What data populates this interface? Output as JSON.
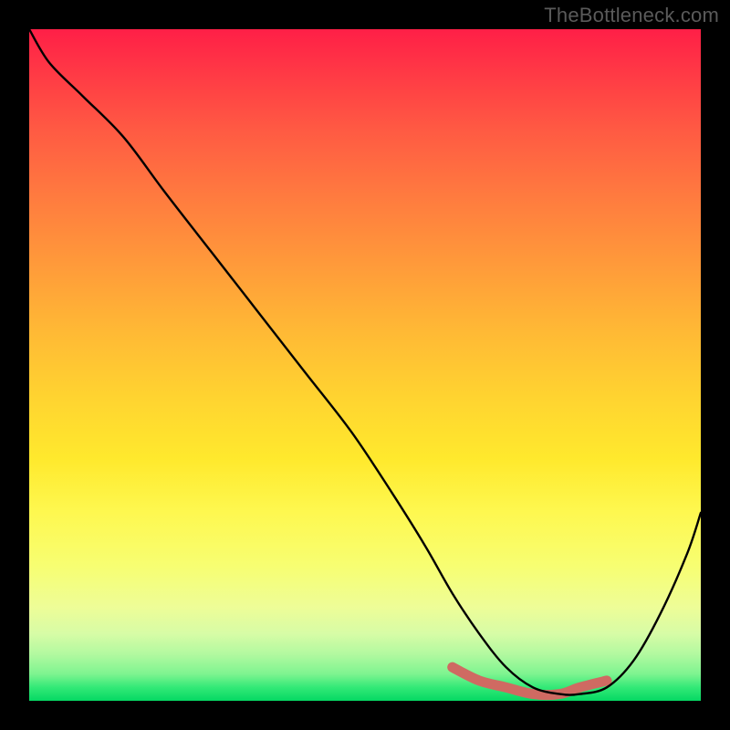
{
  "watermark": "TheBottleneck.com",
  "colors": {
    "page_bg": "#000000",
    "curve": "#000000",
    "ridge": "#cf6a62"
  },
  "chart_data": {
    "type": "line",
    "title": "",
    "xlabel": "",
    "ylabel": "",
    "xlim": [
      0,
      100
    ],
    "ylim": [
      0,
      100
    ],
    "grid": false,
    "legend": false,
    "series": [
      {
        "name": "bottleneck-curve",
        "x": [
          0,
          3,
          8,
          14,
          20,
          27,
          34,
          41,
          48,
          54,
          59,
          63,
          67,
          71,
          75,
          79,
          82,
          86,
          90,
          94,
          98,
          100
        ],
        "y": [
          100,
          95,
          90,
          84,
          76,
          67,
          58,
          49,
          40,
          31,
          23,
          16,
          10,
          5,
          2,
          1,
          1,
          2,
          6,
          13,
          22,
          28
        ]
      }
    ],
    "highlight": {
      "name": "trough-ridge",
      "x": [
        63,
        67,
        71,
        75,
        79,
        82,
        86
      ],
      "y": [
        5,
        3,
        2,
        1,
        1,
        2,
        3
      ]
    },
    "background_gradient": {
      "direction": "top-to-bottom",
      "stops": [
        {
          "pos": 0.0,
          "color": "#ff1f47"
        },
        {
          "pos": 0.25,
          "color": "#ff7b3f"
        },
        {
          "pos": 0.55,
          "color": "#ffd430"
        },
        {
          "pos": 0.8,
          "color": "#f7fe72"
        },
        {
          "pos": 1.0,
          "color": "#05d863"
        }
      ]
    }
  }
}
